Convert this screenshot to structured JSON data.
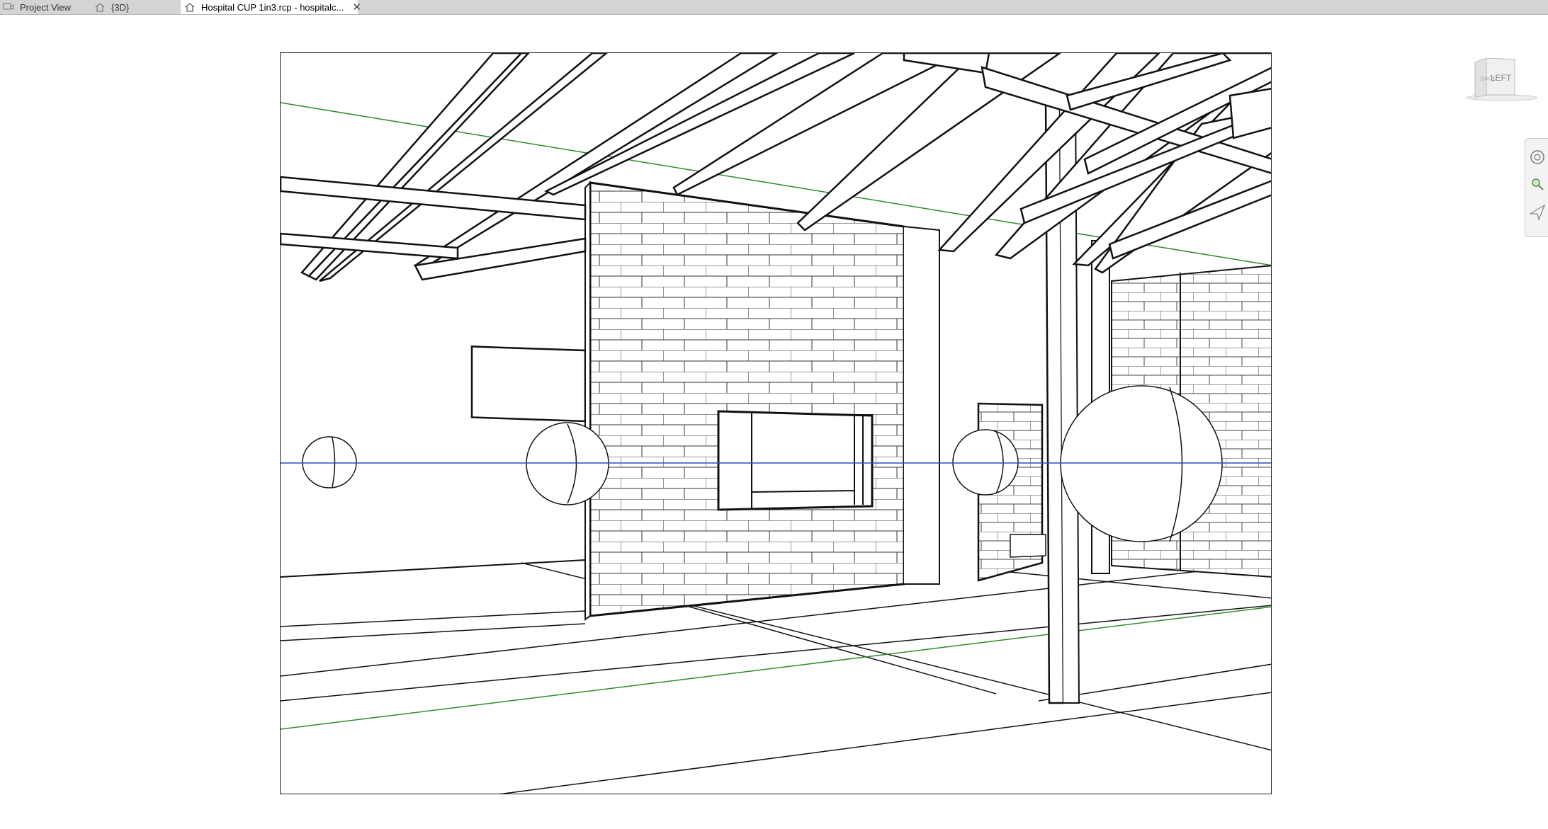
{
  "tabs": [
    {
      "label": "Project View",
      "icon": "project-view-icon",
      "active": false
    },
    {
      "label": "{3D}",
      "icon": "home-icon",
      "active": false
    },
    {
      "label": "Hospital CUP 1in3.rcp - hospitalc...",
      "icon": "home-icon",
      "active": true
    }
  ],
  "viewcube": {
    "face_label": "LEFT",
    "side_label": "BACK"
  },
  "navigation_bar": {
    "items": [
      "steering-wheel-icon",
      "zoom-icon",
      "fly-icon"
    ]
  },
  "colors": {
    "grid_green": "#2e8b2e",
    "level_blue": "#2b4fc7",
    "tabbar": "#d4d4d4"
  }
}
